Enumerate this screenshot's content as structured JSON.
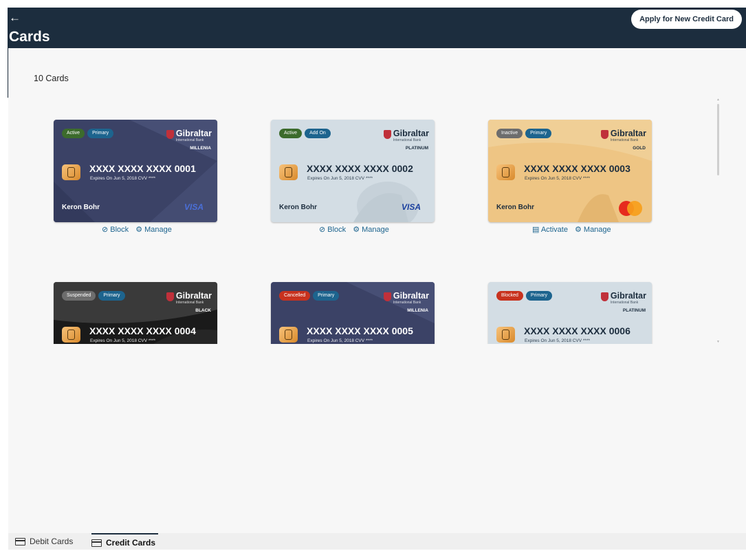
{
  "header": {
    "back_icon": "arrow-left-icon",
    "title": "Cards",
    "apply_label": "Apply for New Credit Card"
  },
  "summary": {
    "count_label": "10 Cards"
  },
  "cards": [
    {
      "badges": [
        "Active",
        "Primary"
      ],
      "brand": "Gibraltar",
      "brand_sub": "International Bank",
      "tier": "MILLENIA",
      "number": "XXXX XXXX XXXX 0001",
      "expiry": "Expires On Jun 5, 2018   CVV ****",
      "holder": "Keron Bohr",
      "network": "VISA",
      "actions": [
        "Block",
        "Manage"
      ]
    },
    {
      "badges": [
        "Active",
        "Add On"
      ],
      "brand": "Gibraltar",
      "brand_sub": "International Bank",
      "tier": "PLATINUM",
      "number": "XXXX XXXX XXXX 0002",
      "expiry": "Expires On Jun 5, 2018   CVV ****",
      "holder": "Keron Bohr",
      "network": "VISA",
      "actions": [
        "Block",
        "Manage"
      ]
    },
    {
      "badges": [
        "Inactive",
        "Primary"
      ],
      "brand": "Gibraltar",
      "brand_sub": "International Bank",
      "tier": "GOLD",
      "number": "XXXX XXXX XXXX 0003",
      "expiry": "Expires On Jun 5, 2018   CVV ****",
      "holder": "Keron Bohr",
      "network": "Mastercard",
      "actions": [
        "Activate",
        "Manage"
      ]
    },
    {
      "badges": [
        "Suspended",
        "Primary"
      ],
      "brand": "Gibraltar",
      "brand_sub": "International Bank",
      "tier": "BLACK",
      "number": "XXXX XXXX XXXX 0004",
      "expiry": "Expires On Jun 5, 2018   CVV ****"
    },
    {
      "badges": [
        "Cancelled",
        "Primary"
      ],
      "brand": "Gibraltar",
      "brand_sub": "International Bank",
      "tier": "MILLENIA",
      "number": "XXXX XXXX XXXX 0005",
      "expiry": "Expires On Jun 5, 2018   CVV ****"
    },
    {
      "badges": [
        "Blocked",
        "Primary"
      ],
      "brand": "Gibraltar",
      "brand_sub": "International Bank",
      "tier": "PLATINUM",
      "number": "XXXX XXXX XXXX 0006",
      "expiry": "Expires On Jun 5, 2018   CVV ****"
    }
  ],
  "tabs": [
    {
      "label": "Debit Cards",
      "icon": "card-icon",
      "active": false
    },
    {
      "label": "Credit Cards",
      "icon": "card-icon",
      "active": true
    }
  ],
  "colors": {
    "header": "#1c2d3e",
    "link": "#1d648e",
    "active_badge": "#3c6b2c",
    "primary_badge": "#1d648e",
    "danger_badge": "#c8321e"
  }
}
